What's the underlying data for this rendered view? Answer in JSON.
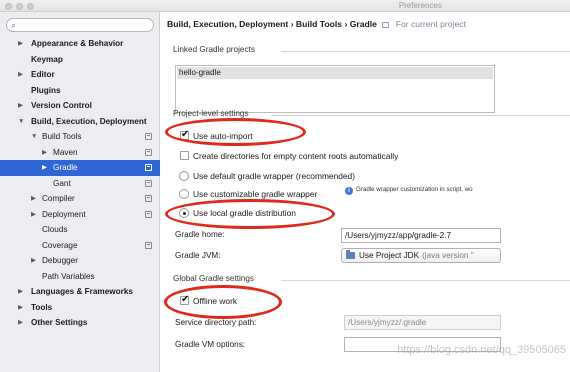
{
  "window": {
    "title": "Preferences"
  },
  "search": {
    "placeholder": "",
    "value": "",
    "icon": "search-icon"
  },
  "sidebar": {
    "items": [
      {
        "label": "Appearance & Behavior",
        "expanded": false,
        "bold": true
      },
      {
        "label": "Keymap",
        "bold": true
      },
      {
        "label": "Editor",
        "expanded": false,
        "bold": true
      },
      {
        "label": "Plugins",
        "bold": true
      },
      {
        "label": "Version Control",
        "expanded": false,
        "bold": true
      },
      {
        "label": "Build, Execution, Deployment",
        "expanded": true,
        "bold": true
      },
      {
        "label": "Build Tools",
        "expanded": true
      },
      {
        "label": "Maven",
        "expanded": false
      },
      {
        "label": "Gradle",
        "expanded": false,
        "selected": true
      },
      {
        "label": "Gant"
      },
      {
        "label": "Compiler",
        "expanded": false
      },
      {
        "label": "Deployment",
        "expanded": false
      },
      {
        "label": "Clouds"
      },
      {
        "label": "Coverage"
      },
      {
        "label": "Debugger",
        "expanded": false
      },
      {
        "label": "Path Variables"
      },
      {
        "label": "Languages & Frameworks",
        "expanded": false,
        "bold": true
      },
      {
        "label": "Tools",
        "expanded": false,
        "bold": true
      },
      {
        "label": "Other Settings",
        "expanded": false,
        "bold": true
      }
    ]
  },
  "breadcrumb": {
    "path": "Build, Execution, Deployment › Build Tools › Gradle",
    "scope": "For current project"
  },
  "linked": {
    "section": "Linked Gradle projects",
    "projects": [
      "hello-gradle"
    ]
  },
  "project_settings": {
    "section": "Project-level settings",
    "auto_import": {
      "label": "Use auto-import",
      "checked": true
    },
    "create_dirs": {
      "label": "Create directories for empty content roots automatically",
      "checked": false
    },
    "default_wrapper": {
      "label": "Use default gradle wrapper (recommended)",
      "selected": false
    },
    "custom_wrapper": {
      "label": "Use customizable gradle wrapper",
      "selected": false
    },
    "wrapper_info": "Gradle wrapper customization in script, wo",
    "local_dist": {
      "label": "Use local gradle distribution",
      "selected": true
    },
    "gradle_home": {
      "label": "Gradle home:",
      "value": "/Users/yjmyzz/app/gradle-2.7"
    },
    "gradle_jvm": {
      "label": "Gradle JVM:",
      "value": "Use Project JDK",
      "version": "(java version \""
    }
  },
  "global_settings": {
    "section": "Global Gradle settings",
    "offline": {
      "label": "Offline work",
      "checked": true
    },
    "service_dir": {
      "label": "Service directory path:",
      "value": "/Users/yjmyzz/.gradle"
    },
    "vm_options": {
      "label": "Gradle VM options:",
      "value": ""
    }
  },
  "watermark": "https://blog.csdn.net/qq_39505065",
  "colors": {
    "selection": "#2f67d6",
    "annotation": "#e0281b"
  }
}
